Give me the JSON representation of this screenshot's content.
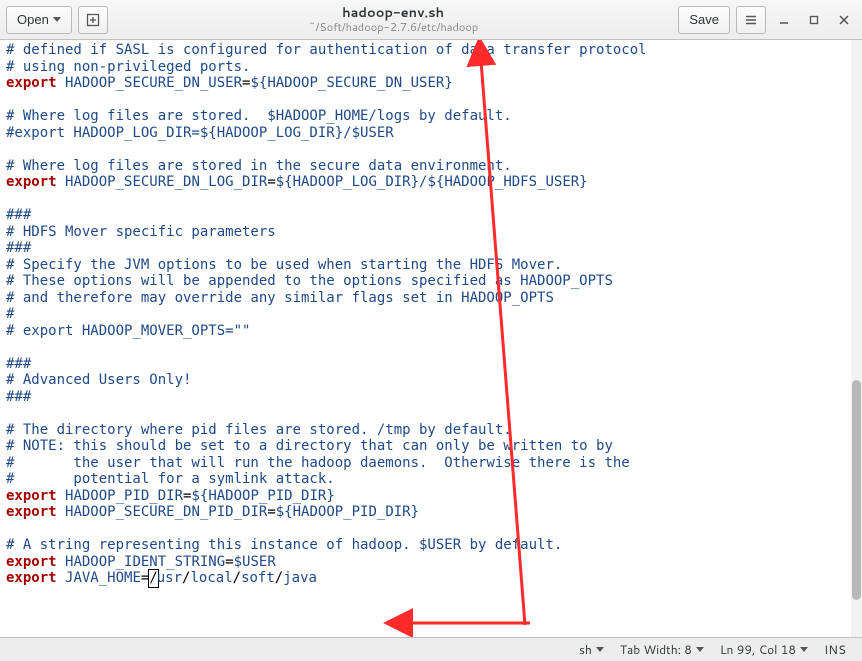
{
  "header": {
    "open_label": "Open",
    "save_label": "Save",
    "title": "hadoop-env.sh",
    "subtitle": "~/Soft/hadoop-2.7.6/etc/hadoop"
  },
  "editor": {
    "lines": [
      {
        "t": "com",
        "text": "# defined if SASL is configured for authentication of data transfer protocol"
      },
      {
        "t": "com",
        "text": "# using non-privileged ports."
      },
      {
        "t": "export",
        "var": "HADOOP_SECURE_DN_USER",
        "val": "${HADOOP_SECURE_DN_USER}"
      },
      {
        "t": "blank"
      },
      {
        "t": "com",
        "text": "# Where log files are stored.  $HADOOP_HOME/logs by default."
      },
      {
        "t": "com",
        "text": "#export HADOOP_LOG_DIR=${HADOOP_LOG_DIR}/$USER"
      },
      {
        "t": "blank"
      },
      {
        "t": "com",
        "text": "# Where log files are stored in the secure data environment."
      },
      {
        "t": "export",
        "var": "HADOOP_SECURE_DN_LOG_DIR",
        "val": "${HADOOP_LOG_DIR}/${HADOOP_HDFS_USER}"
      },
      {
        "t": "blank"
      },
      {
        "t": "com",
        "text": "###"
      },
      {
        "t": "com",
        "text": "# HDFS Mover specific parameters"
      },
      {
        "t": "com",
        "text": "###"
      },
      {
        "t": "com",
        "text": "# Specify the JVM options to be used when starting the HDFS Mover."
      },
      {
        "t": "com",
        "text": "# These options will be appended to the options specified as HADOOP_OPTS"
      },
      {
        "t": "com",
        "text": "# and therefore may override any similar flags set in HADOOP_OPTS"
      },
      {
        "t": "com",
        "text": "#"
      },
      {
        "t": "com",
        "text": "# export HADOOP_MOVER_OPTS=\"\""
      },
      {
        "t": "blank"
      },
      {
        "t": "com",
        "text": "###"
      },
      {
        "t": "com",
        "text": "# Advanced Users Only!"
      },
      {
        "t": "com",
        "text": "###"
      },
      {
        "t": "blank"
      },
      {
        "t": "com",
        "text": "# The directory where pid files are stored. /tmp by default."
      },
      {
        "t": "com",
        "text": "# NOTE: this should be set to a directory that can only be written to by"
      },
      {
        "t": "com",
        "text": "#       the user that will run the hadoop daemons.  Otherwise there is the"
      },
      {
        "t": "com",
        "text": "#       potential for a symlink attack."
      },
      {
        "t": "export",
        "var": "HADOOP_PID_DIR",
        "val": "${HADOOP_PID_DIR}"
      },
      {
        "t": "export",
        "var": "HADOOP_SECURE_DN_PID_DIR",
        "val": "${HADOOP_PID_DIR}"
      },
      {
        "t": "blank"
      },
      {
        "t": "com",
        "text": "# A string representing this instance of hadoop. $USER by default."
      },
      {
        "t": "export",
        "var": "HADOOP_IDENT_STRING",
        "val": "$USER"
      },
      {
        "t": "export_java",
        "var": "JAVA_HOME",
        "path": [
          "usr",
          "local",
          "soft",
          "java"
        ]
      }
    ]
  },
  "status": {
    "language": "sh",
    "tab_width": "Tab Width: 8",
    "position": "Ln 99, Col 18",
    "insert_mode": "INS"
  }
}
